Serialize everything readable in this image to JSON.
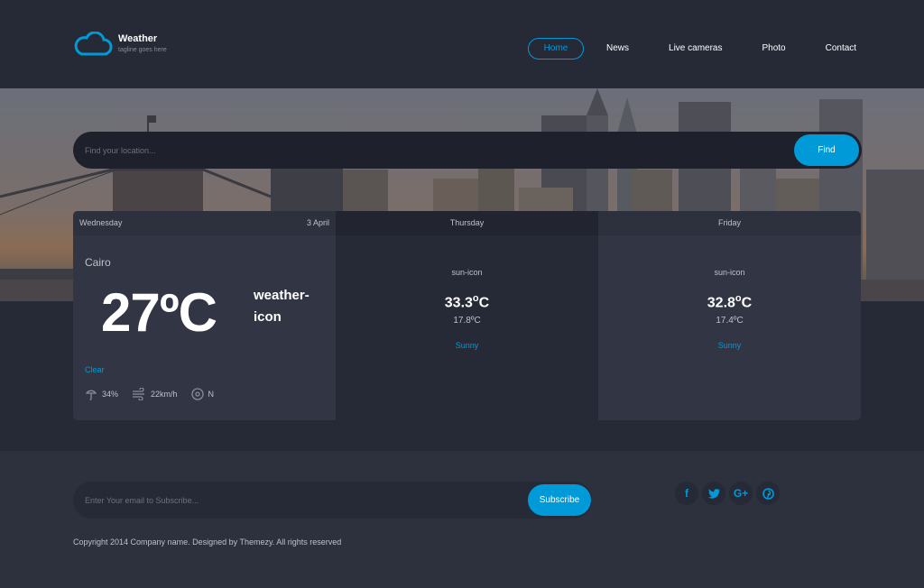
{
  "brand": {
    "title": "Weather",
    "tagline": "tagline goes here",
    "accent": "#009ad8"
  },
  "nav": {
    "items": [
      {
        "label": "Home",
        "active": true
      },
      {
        "label": "News"
      },
      {
        "label": "Live cameras"
      },
      {
        "label": "Photo"
      },
      {
        "label": "Contact"
      }
    ]
  },
  "search": {
    "placeholder": "Find your location...",
    "button": "Find"
  },
  "today": {
    "day": "Wednesday",
    "date": "3 April",
    "location": "Cairo",
    "temp": "27ºC",
    "icon_alt": "weather-icon",
    "condition": "Clear",
    "humidity": "34%",
    "wind": "22km/h",
    "direction": "N"
  },
  "forecast": [
    {
      "day": "Thursday",
      "icon_alt": "sun-icon",
      "high": "33.3",
      "unit": "o",
      "high_c": "C",
      "low": "17.8ºC",
      "condition": "Sunny"
    },
    {
      "day": "Friday",
      "icon_alt": "sun-icon",
      "high": "32.8",
      "unit": "o",
      "high_c": "C",
      "low": "17.4ºC",
      "condition": "Sunny"
    }
  ],
  "subscribe": {
    "placeholder": "Enter Your email to Subscribe...",
    "button": "Subscribe"
  },
  "social": {
    "facebook": "f",
    "twitter": "twitter-icon",
    "google": "G+",
    "pinterest": "pinterest-icon"
  },
  "copyright": "Copyright 2014 Company name. Designed by Themezy. All rights reserved"
}
